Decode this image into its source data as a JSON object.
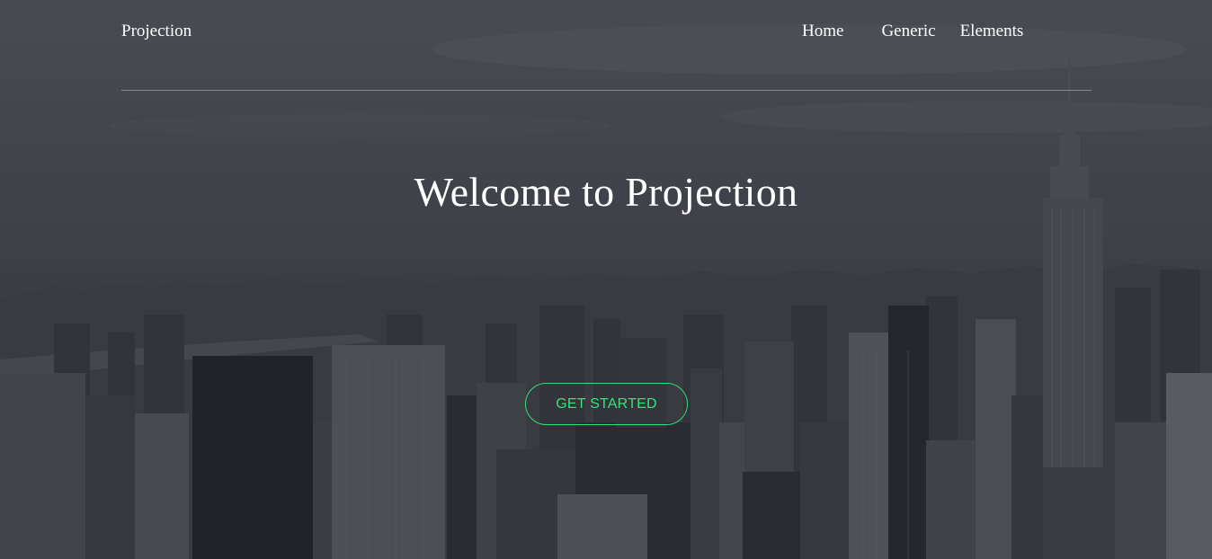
{
  "brand": {
    "name": "Projection"
  },
  "nav": {
    "items": [
      {
        "label": "Home"
      },
      {
        "label": "Generic"
      },
      {
        "label": "Elements"
      }
    ]
  },
  "hero": {
    "title": "Welcome to Projection",
    "cta_label": "GET STARTED",
    "background_image": "city-skyline"
  },
  "colors": {
    "accent": "#2fe07a",
    "text": "#ffffff",
    "background": "#4a4b52"
  }
}
